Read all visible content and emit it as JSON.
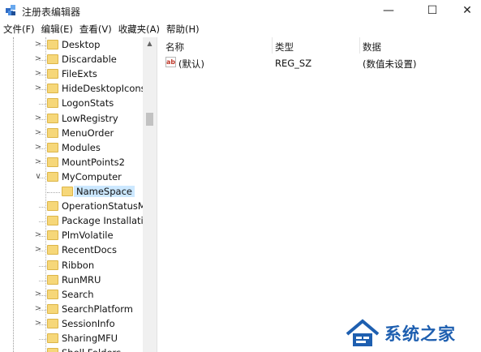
{
  "window": {
    "title": "注册表编辑器",
    "minimize_glyph": "—",
    "maximize_glyph": "☐",
    "close_glyph": "✕"
  },
  "menu": [
    "文件(F)",
    "编辑(E)",
    "查看(V)",
    "收藏夹(A)",
    "帮助(H)"
  ],
  "tree": {
    "items": [
      {
        "label": "Desktop",
        "expander": ">"
      },
      {
        "label": "Discardable",
        "expander": ">"
      },
      {
        "label": "FileExts",
        "expander": ">"
      },
      {
        "label": "HideDesktopIcons",
        "expander": ">"
      },
      {
        "label": "LogonStats",
        "expander": ""
      },
      {
        "label": "LowRegistry",
        "expander": ">"
      },
      {
        "label": "MenuOrder",
        "expander": ">"
      },
      {
        "label": "Modules",
        "expander": ">"
      },
      {
        "label": "MountPoints2",
        "expander": ">"
      },
      {
        "label": "MyComputer",
        "expander": "v"
      },
      {
        "label": "NameSpace",
        "expander": "",
        "child": true,
        "selected": true
      },
      {
        "label": "OperationStatusMa",
        "expander": ""
      },
      {
        "label": "Package Installatio",
        "expander": ""
      },
      {
        "label": "PlmVolatile",
        "expander": ">"
      },
      {
        "label": "RecentDocs",
        "expander": ">"
      },
      {
        "label": "Ribbon",
        "expander": ""
      },
      {
        "label": "RunMRU",
        "expander": ""
      },
      {
        "label": "Search",
        "expander": ">"
      },
      {
        "label": "SearchPlatform",
        "expander": ">"
      },
      {
        "label": "SessionInfo",
        "expander": ">"
      },
      {
        "label": "SharingMFU",
        "expander": ""
      },
      {
        "label": "Shell Folders",
        "expander": ""
      }
    ]
  },
  "list": {
    "columns": {
      "name": "名称",
      "type": "类型",
      "data": "数据"
    },
    "rows": [
      {
        "icon": "ab",
        "name": "(默认)",
        "type": "REG_SZ",
        "data": "(数值未设置)"
      }
    ]
  },
  "watermark": {
    "text": "系统之家"
  },
  "colors": {
    "folder": "#f6d779",
    "selection": "#cce8ff",
    "watermark": "#1e5fb0"
  }
}
